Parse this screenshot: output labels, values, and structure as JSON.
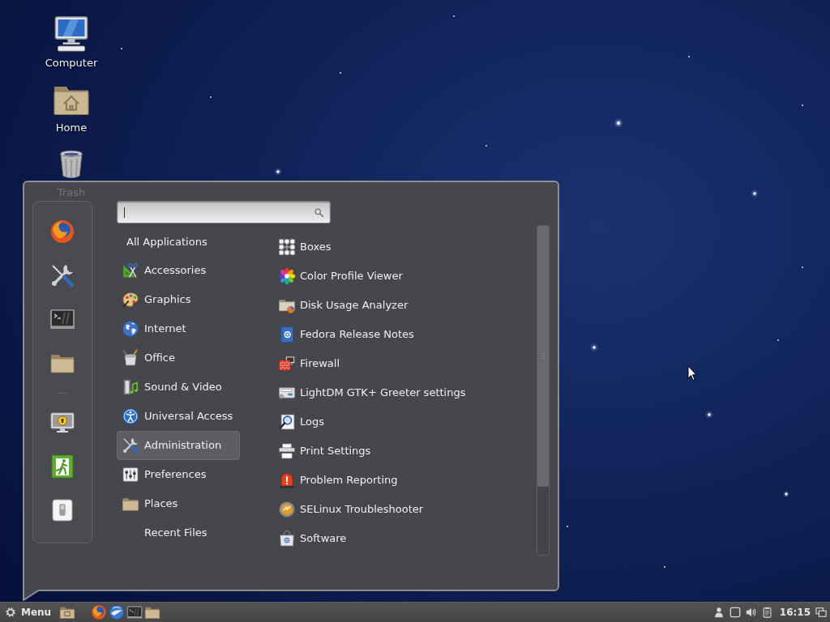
{
  "desktop": {
    "icons": [
      {
        "label": "Computer",
        "kind": "computer",
        "dimmed": false
      },
      {
        "label": "Home",
        "kind": "home",
        "dimmed": false
      },
      {
        "label": "Trash",
        "kind": "trash",
        "dimmed": true
      }
    ]
  },
  "menu": {
    "favorites": [
      {
        "kind": "firefox"
      },
      {
        "kind": "tools"
      },
      {
        "kind": "terminal"
      },
      {
        "kind": "folder"
      }
    ],
    "session": [
      {
        "kind": "lock-screen"
      },
      {
        "kind": "logout"
      },
      {
        "kind": "power"
      }
    ],
    "search": {
      "focused": true
    },
    "categories": [
      {
        "label": "All Applications",
        "kind": "all",
        "selected": false
      },
      {
        "label": "Accessories",
        "kind": "accessories",
        "selected": false
      },
      {
        "label": "Graphics",
        "kind": "graphics",
        "selected": false
      },
      {
        "label": "Internet",
        "kind": "internet",
        "selected": false
      },
      {
        "label": "Office",
        "kind": "office",
        "selected": false
      },
      {
        "label": "Sound & Video",
        "kind": "sound-video",
        "selected": false
      },
      {
        "label": "Universal Access",
        "kind": "universal-access",
        "selected": false
      },
      {
        "label": "Administration",
        "kind": "tools",
        "selected": true
      },
      {
        "label": "Preferences",
        "kind": "preferences",
        "selected": false
      },
      {
        "label": "Places",
        "kind": "folder",
        "selected": false
      },
      {
        "label": "Recent Files",
        "kind": "recent",
        "selected": false
      }
    ],
    "apps": [
      {
        "label": "Boxes",
        "kind": "boxes"
      },
      {
        "label": "Color Profile Viewer",
        "kind": "color-profile"
      },
      {
        "label": "Disk Usage Analyzer",
        "kind": "disk-usage"
      },
      {
        "label": "Fedora Release Notes",
        "kind": "release-notes"
      },
      {
        "label": "Firewall",
        "kind": "firewall"
      },
      {
        "label": "LightDM GTK+ Greeter settings",
        "kind": "greeter"
      },
      {
        "label": "Logs",
        "kind": "logs"
      },
      {
        "label": "Print Settings",
        "kind": "print"
      },
      {
        "label": "Problem Reporting",
        "kind": "problem"
      },
      {
        "label": "SELinux Troubleshooter",
        "kind": "selinux"
      },
      {
        "label": "Software",
        "kind": "software"
      }
    ]
  },
  "taskbar": {
    "menu_label": "Menu",
    "applets": [
      {
        "kind": "folder-screen"
      }
    ],
    "launchers": [
      {
        "kind": "firefox"
      },
      {
        "kind": "thunderbird"
      },
      {
        "kind": "terminal"
      },
      {
        "kind": "folder"
      }
    ],
    "tray": [
      {
        "kind": "user"
      },
      {
        "kind": "window"
      },
      {
        "kind": "volume"
      },
      {
        "kind": "clipboard"
      }
    ],
    "clock": "16:15",
    "tray_end": [
      {
        "kind": "show-desktop"
      }
    ]
  }
}
